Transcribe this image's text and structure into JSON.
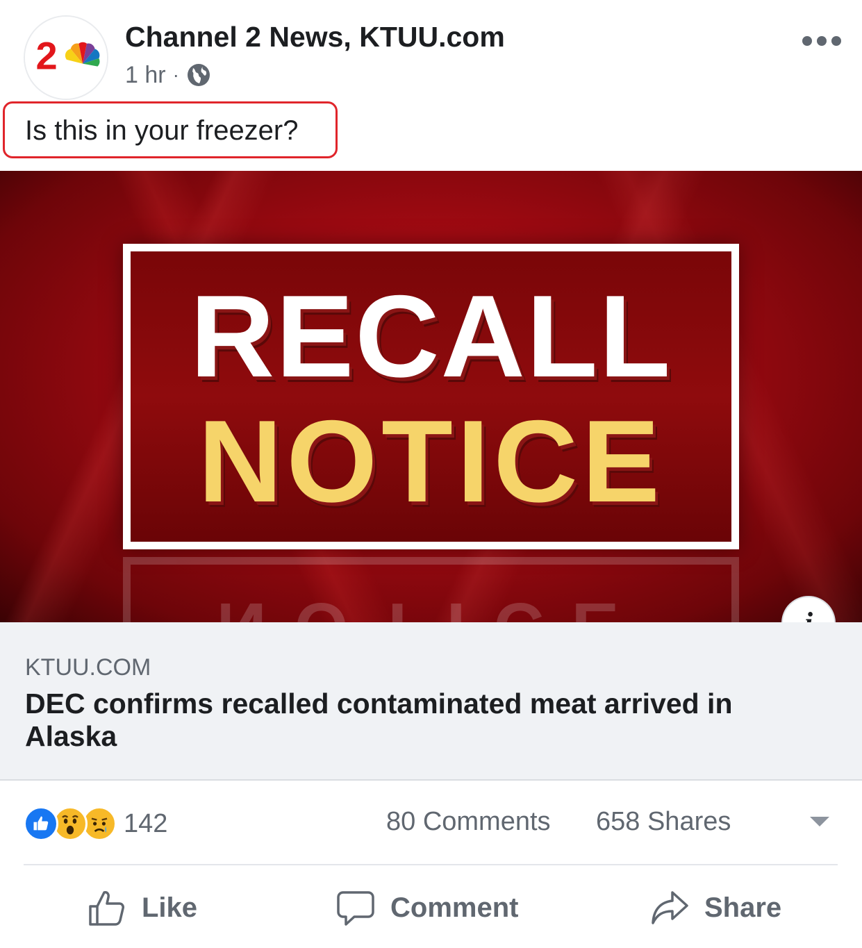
{
  "header": {
    "page_name": "Channel 2 News, KTUU.com",
    "time": "1 hr",
    "separator": "·",
    "avatar_text": "2",
    "privacy_icon": "globe-icon",
    "more_icon": "more-dots-icon"
  },
  "post": {
    "text": "Is this in your freezer?",
    "highlight_color": "#e0252b"
  },
  "link_preview": {
    "image_headline_line1": "RECALL",
    "image_headline_line2": "NOTICE",
    "info_label": "i",
    "domain": "KTUU.COM",
    "title": "DEC confirms recalled contaminated meat arrived in Alaska"
  },
  "stats": {
    "reaction_icons": [
      "like-reaction-icon",
      "wow-reaction-icon",
      "sad-reaction-icon"
    ],
    "reaction_count": "142",
    "comments": "80 Comments",
    "shares": "658 Shares"
  },
  "actions": {
    "like": "Like",
    "comment": "Comment",
    "share": "Share"
  },
  "colors": {
    "text": "#1c1e21",
    "secondary": "#606770",
    "like_blue": "#1877f2",
    "banner_red": "#a10a12",
    "notice_yellow": "#f6d46a"
  }
}
